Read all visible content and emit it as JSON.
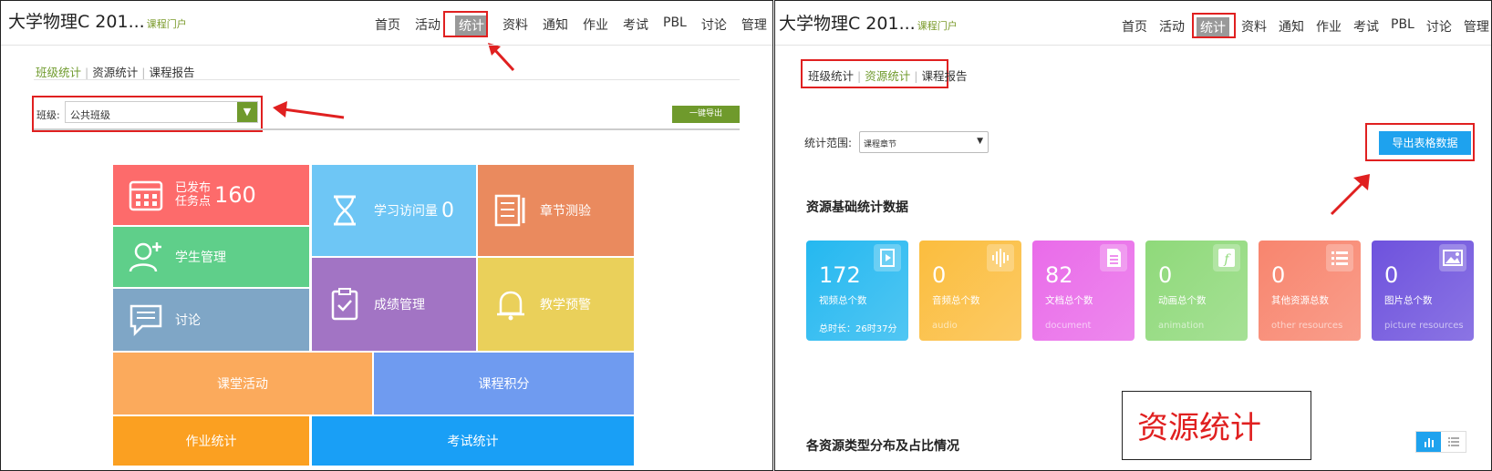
{
  "left": {
    "course_title": "大学物理C  201...",
    "portal_link": "课程门户",
    "nav": [
      "首页",
      "活动",
      "统计",
      "资料",
      "通知",
      "作业",
      "考试",
      "PBL",
      "讨论",
      "管理"
    ],
    "active_nav": "统计",
    "subtabs": [
      "班级统计",
      "资源统计",
      "课程报告"
    ],
    "class_label": "班级:",
    "class_select_value": "公共班级",
    "export_button": "一键导出",
    "tiles": {
      "published_line1": "已发布",
      "published_line2": "任务点",
      "published_count": "160",
      "visits_label": "学习访问量",
      "visits_count": "0",
      "chapter_quiz": "章节测验",
      "student_mgmt": "学生管理",
      "grade_mgmt": "成绩管理",
      "discussion": "讨论",
      "teaching_alert": "教学预警",
      "class_activity": "课堂活动",
      "course_points": "课程积分",
      "homework_stats": "作业统计",
      "exam_stats": "考试统计"
    },
    "colors": {
      "accent_green": "#6f9a2c",
      "tile_red": "#fd6b6b",
      "tile_blue": "#6ec6f5",
      "tile_orange": "#ea8a5e",
      "tile_green": "#5fcf8a",
      "tile_purple": "#a274c4",
      "tile_yellow": "#ead05a",
      "tile_steel": "#7fa6c6",
      "tile_lightorange": "#fbaa5c",
      "tile_periwinkle": "#6f9bf0",
      "tile_amber": "#fba021",
      "tile_sky": "#199ff6"
    }
  },
  "right": {
    "course_title": "大学物理C  201...",
    "portal_link": "课程门户",
    "nav": [
      "首页",
      "活动",
      "统计",
      "资料",
      "通知",
      "作业",
      "考试",
      "PBL",
      "讨论",
      "管理"
    ],
    "active_nav": "统计",
    "subtabs": [
      "班级统计",
      "资源统计",
      "课程报告"
    ],
    "scope_label": "统计范围:",
    "scope_select_value": "课程章节",
    "export_button": "导出表格数据",
    "section_title": "资源基础统计数据",
    "cards": [
      {
        "value": "172",
        "label": "视频总个数",
        "sub": "总时长：26时37分",
        "icon": "video-icon",
        "color": "#25b8f0"
      },
      {
        "value": "0",
        "label": "音频总个数",
        "sub": "audio",
        "icon": "audio-icon",
        "color": "#fbbd3e"
      },
      {
        "value": "82",
        "label": "文档总个数",
        "sub": "document",
        "icon": "document-icon",
        "color": "#e96be9"
      },
      {
        "value": "0",
        "label": "动画总个数",
        "sub": "animation",
        "icon": "animation-icon",
        "color": "#8fd97a"
      },
      {
        "value": "0",
        "label": "其他资源总数",
        "sub": "other resources",
        "icon": "list-icon",
        "color": "#f8856e"
      },
      {
        "value": "0",
        "label": "图片总个数",
        "sub": "picture resources",
        "icon": "picture-icon",
        "color": "#6e52dd"
      }
    ],
    "annotation": "资源统计",
    "distribution_title": "各资源类型分布及占比情况"
  }
}
